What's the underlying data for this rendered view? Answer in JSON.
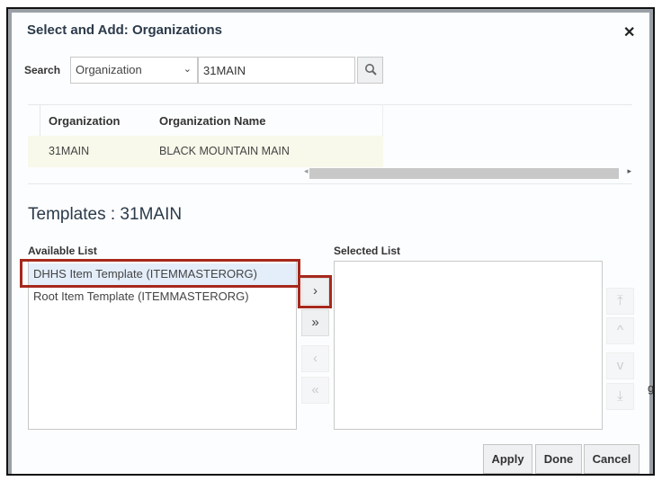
{
  "dialog": {
    "title": "Select and Add: Organizations",
    "close_icon": "close-icon"
  },
  "search": {
    "label": "Search",
    "field": "Organization",
    "value": "31MAIN"
  },
  "table": {
    "headers": [
      "Organization",
      "Organization Name"
    ],
    "rows": [
      [
        "31MAIN",
        "BLACK MOUNTAIN MAIN"
      ]
    ]
  },
  "templates": {
    "title": "Templates : 31MAIN",
    "available_label": "Available List",
    "selected_label": "Selected List",
    "available": [
      "DHHS Item Template (ITEMMASTERORG)",
      "Root Item Template (ITEMMASTERORG)"
    ],
    "selected": []
  },
  "shuttle": {
    "move": "›",
    "move_all": "»",
    "remove": "‹",
    "remove_all": "«",
    "top": "⤒",
    "up": "^",
    "down": "v",
    "bottom": "⤓"
  },
  "buttons": {
    "apply": "Apply",
    "done": "Done",
    "cancel": "Cancel"
  },
  "stray_text": "g",
  "colors": {
    "highlight": "#a7281c",
    "selected_row": "#f8f9ea"
  }
}
